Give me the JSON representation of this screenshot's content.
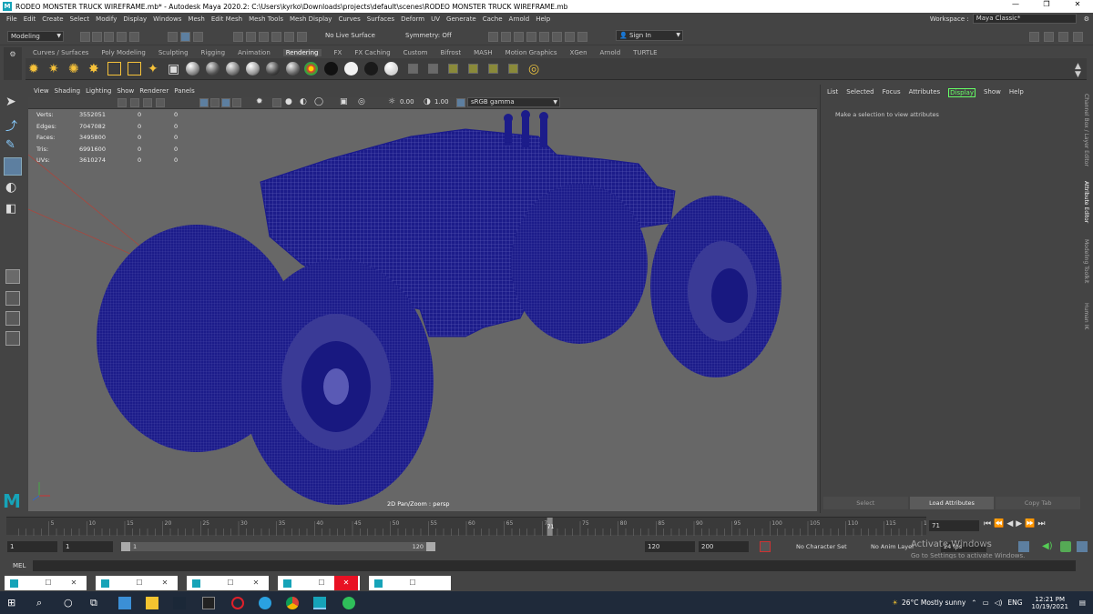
{
  "window": {
    "title": "RODEO MONSTER TRUCK WIREFRAME.mb* - Autodesk Maya 2020.2: C:\\Users\\kyrko\\Downloads\\projects\\default\\scenes\\RODEO MONSTER TRUCK WIREFRAME.mb",
    "controls": [
      "—",
      "❐",
      "✕"
    ]
  },
  "menubar": {
    "items": [
      "File",
      "Edit",
      "Create",
      "Select",
      "Modify",
      "Display",
      "Windows",
      "Mesh",
      "Edit Mesh",
      "Mesh Tools",
      "Mesh Display",
      "Curves",
      "Surfaces",
      "Deform",
      "UV",
      "Generate",
      "Cache",
      "Arnold",
      "Help"
    ],
    "workspace_label": "Workspace :",
    "workspace_value": "Maya Classic*"
  },
  "statusline": {
    "mode": "Modeling",
    "live_surface": "No Live Surface",
    "symmetry": "Symmetry: Off",
    "sign_in": "Sign In"
  },
  "shelf": {
    "tabs": [
      "Curves / Surfaces",
      "Poly Modeling",
      "Sculpting",
      "Rigging",
      "Animation",
      "Rendering",
      "FX",
      "FX Caching",
      "Custom",
      "Bifrost",
      "MASH",
      "Motion Graphics",
      "XGen",
      "Arnold",
      "TURTLE"
    ],
    "active_tab": "Rendering"
  },
  "viewport": {
    "menu": [
      "View",
      "Shading",
      "Lighting",
      "Show",
      "Renderer",
      "Panels"
    ],
    "exposure": "0.00",
    "gamma": "1.00",
    "color_space": "sRGB gamma",
    "camera_label": "2D Pan/Zoom : persp",
    "hud": [
      {
        "label": "Verts:",
        "v1": "3552051",
        "v2": "0",
        "v3": "0"
      },
      {
        "label": "Edges:",
        "v1": "7047082",
        "v2": "0",
        "v3": "0"
      },
      {
        "label": "Faces:",
        "v1": "3495800",
        "v2": "0",
        "v3": "0"
      },
      {
        "label": "Tris:",
        "v1": "6991600",
        "v2": "0",
        "v3": "0"
      },
      {
        "label": "UVs:",
        "v1": "3610274",
        "v2": "0",
        "v3": "0"
      }
    ],
    "wire_color": "#1a1a8c"
  },
  "attribute_editor": {
    "menu": [
      "List",
      "Selected",
      "Focus",
      "Attributes",
      "Display",
      "Show",
      "Help"
    ],
    "highlighted": "Display",
    "message": "Make a selection to view attributes",
    "buttons": [
      "Select",
      "Load Attributes",
      "Copy Tab"
    ]
  },
  "side_tabs": [
    "Channel Box / Layer Editor",
    "Attribute Editor",
    "Modeling Toolkit",
    "Human IK"
  ],
  "timeline": {
    "ticks": [
      "5",
      "10",
      "15",
      "20",
      "25",
      "30",
      "35",
      "40",
      "45",
      "50",
      "55",
      "60",
      "65",
      "70",
      "75",
      "80",
      "85",
      "90",
      "95",
      "100",
      "105",
      "110",
      "115",
      "120"
    ],
    "current_frame": "71",
    "current_field": "71"
  },
  "range": {
    "start": "1",
    "start_inner": "1",
    "slider_start": "1",
    "slider_end": "120",
    "end_inner": "120",
    "end": "200",
    "character_set": "No Character Set",
    "anim_layer": "No Anim Layer",
    "fps": "24 fps"
  },
  "cmdline": {
    "label": "MEL"
  },
  "watermark": {
    "line1": "Activate Windows",
    "line2": "Go to Settings to activate Windows."
  },
  "taskbar": {
    "weather": "26°C  Mostly sunny",
    "lang": "ENG",
    "time": "12:21 PM",
    "date": "10/19/2021"
  }
}
